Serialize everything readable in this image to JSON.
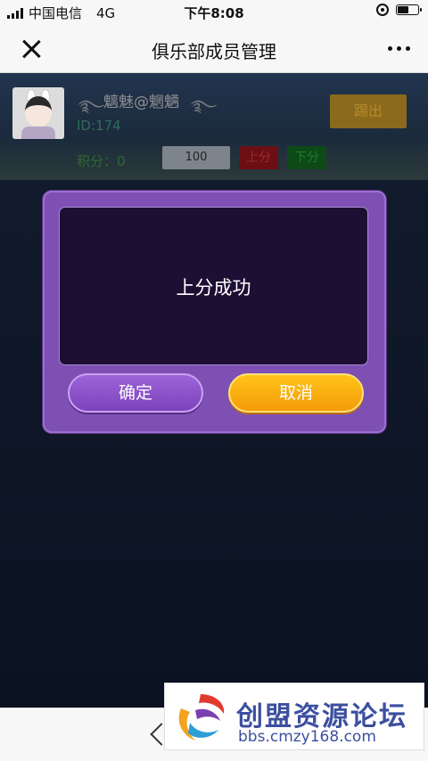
{
  "status_bar": {
    "carrier": "中国电信",
    "network": "4G",
    "time": "下午8:08",
    "battery_level": 0.55
  },
  "nav": {
    "title": "俱乐部成员管理",
    "close_icon": "close-icon",
    "more_icon": "more-icon"
  },
  "member": {
    "name": "魑魅@魍魉",
    "id_text": "ID:174",
    "score_text": "积分：0",
    "score_input_value": "100",
    "up_label": "上分",
    "down_label": "下分",
    "kick_label": "踢出"
  },
  "dialog": {
    "message": "上分成功",
    "confirm_label": "确定",
    "cancel_label": "取消"
  },
  "watermark": {
    "title": "创盟资源论坛",
    "url": "bbs.cmzy168.com"
  },
  "colors": {
    "dialog_bg": "#7e50b3",
    "dialog_inner": "#1d0f33",
    "confirm": "#8a52c9",
    "cancel": "#f7a50d"
  }
}
